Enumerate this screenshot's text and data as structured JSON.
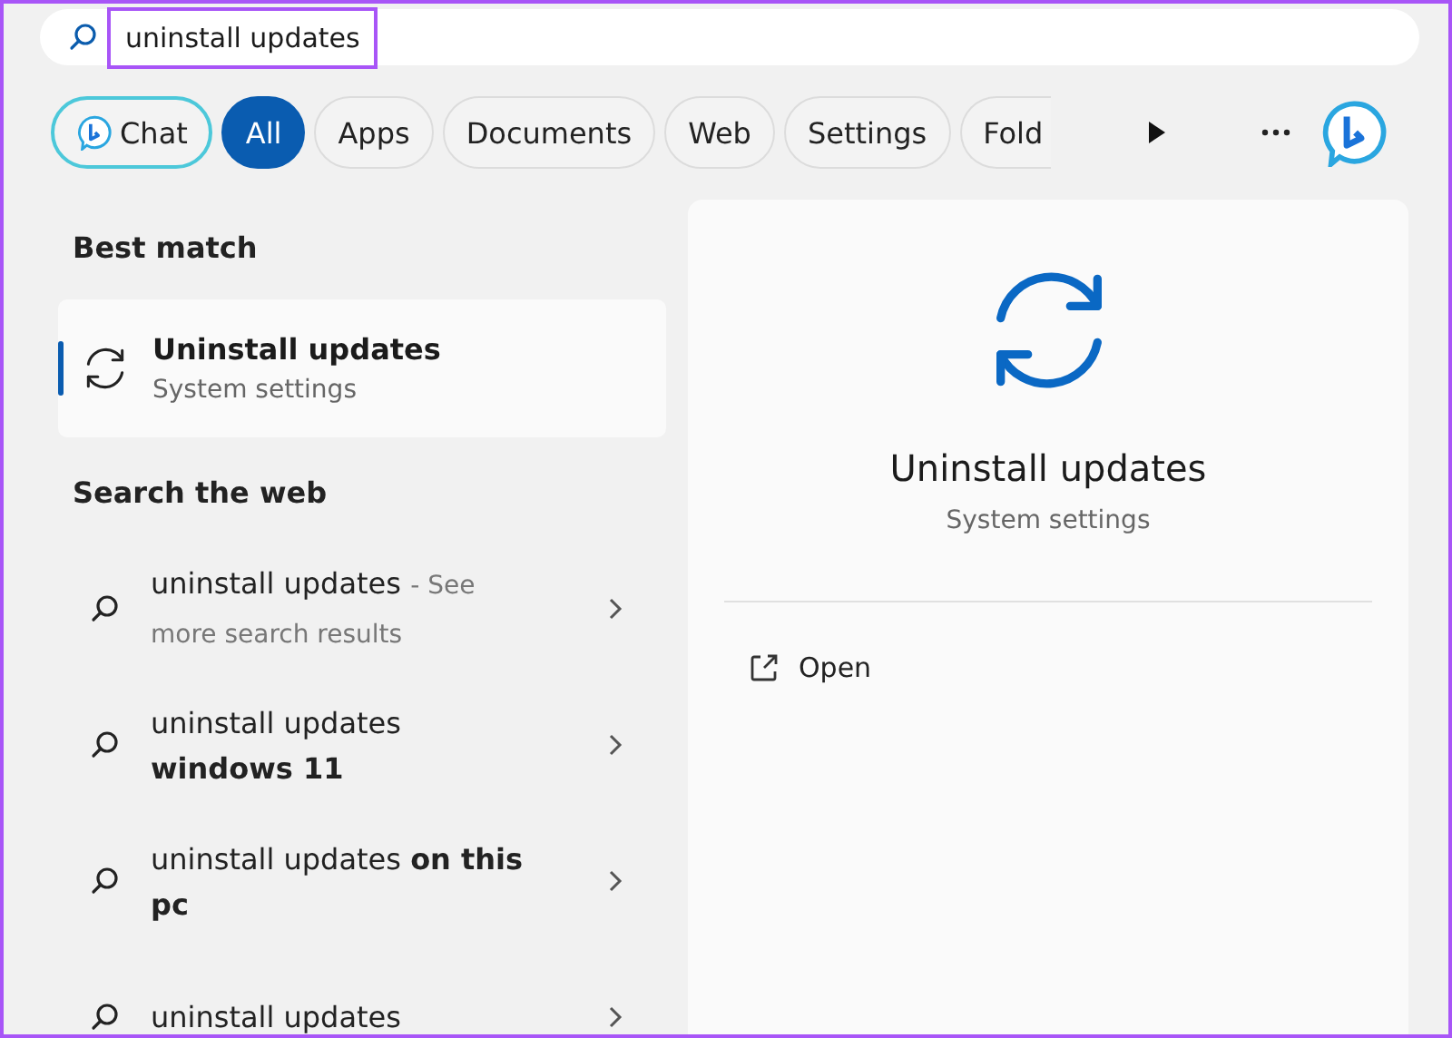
{
  "search": {
    "value": "uninstall updates",
    "highlighted": true
  },
  "filters": [
    {
      "label": "Chat",
      "kind": "chat",
      "selected": false
    },
    {
      "label": "All",
      "kind": "chip",
      "selected": true
    },
    {
      "label": "Apps",
      "kind": "chip",
      "selected": false
    },
    {
      "label": "Documents",
      "kind": "chip",
      "selected": false
    },
    {
      "label": "Web",
      "kind": "chip",
      "selected": false
    },
    {
      "label": "Settings",
      "kind": "chip",
      "selected": false
    },
    {
      "label": "Fold",
      "kind": "cut",
      "selected": false
    }
  ],
  "best_match": {
    "heading": "Best match",
    "title": "Uninstall updates",
    "subtitle": "System settings",
    "selected": true
  },
  "web": {
    "heading": "Search the web",
    "results": [
      {
        "text": "uninstall updates",
        "note": "- See more search results"
      },
      {
        "text": "uninstall updates **windows 11**"
      },
      {
        "text": "uninstall updates **on this pc**"
      },
      {
        "text": "uninstall updates"
      }
    ]
  },
  "detail": {
    "title": "Uninstall updates",
    "subtitle": "System settings",
    "actions": [
      {
        "label": "Open"
      }
    ]
  }
}
